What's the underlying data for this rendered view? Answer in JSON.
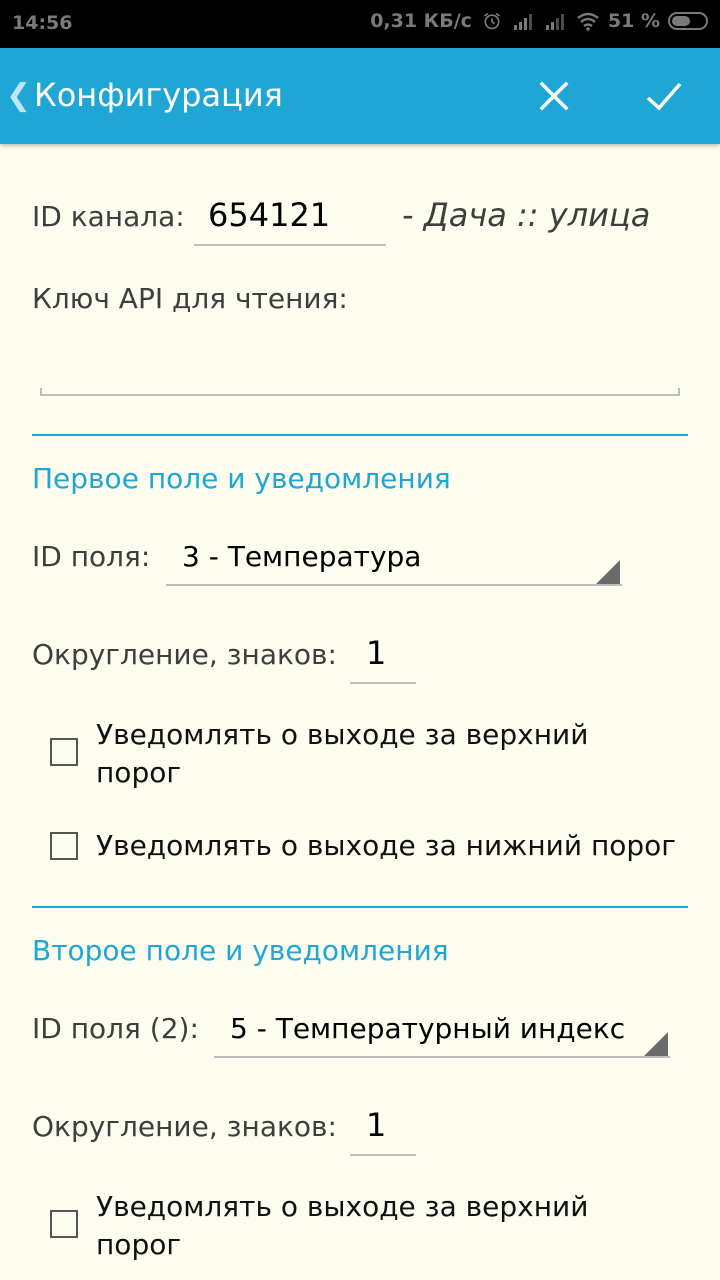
{
  "status_bar": {
    "time": "14:56",
    "speed": "0,31 КБ/с",
    "battery": "51 %"
  },
  "app_bar": {
    "title": "Конфигурация",
    "back_icon": "chevron-left-icon",
    "close_icon": "close-icon",
    "confirm_icon": "check-icon"
  },
  "channel": {
    "label": "ID канала:",
    "value": "654121",
    "name": "- Дача :: улица"
  },
  "api_key": {
    "label": "Ключ API для чтения:",
    "value": ""
  },
  "field1": {
    "section_title": "Первое поле и уведомления",
    "field_label": "ID поля:",
    "field_value": "3 - Температура",
    "rounding_label": "Округление, знаков:",
    "rounding_value": "1",
    "notify_upper": {
      "label_line1": "Уведомлять о выходе за верхний",
      "label_line2": "порог",
      "checked": false
    },
    "notify_lower": {
      "label": "Уведомлять о выходе за нижний порог",
      "checked": false
    }
  },
  "field2": {
    "section_title": "Второе поле и уведомления",
    "field_label": "ID поля (2):",
    "field_value": "5 - Температурный индекс",
    "rounding_label": "Округление, знаков:",
    "rounding_value": "1",
    "notify_upper": {
      "label_line1": "Уведомлять о выходе за верхний",
      "label_line2": "порог",
      "checked": false
    }
  },
  "colors": {
    "accent": "#1ea7d4",
    "background": "#fdfdef",
    "status_bar": "#000000"
  }
}
